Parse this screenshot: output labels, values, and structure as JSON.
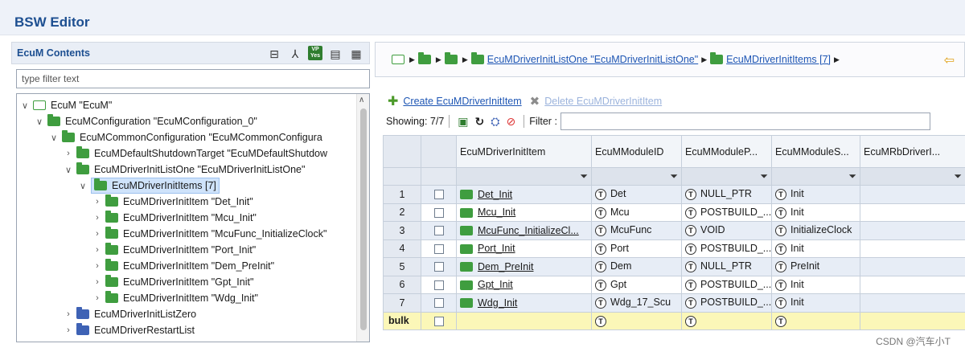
{
  "app": {
    "title": "BSW Editor"
  },
  "left": {
    "title": "EcuM Contents",
    "filter_placeholder": "type filter text",
    "tree": [
      {
        "label": "EcuM \"EcuM\"",
        "twisty": "open",
        "icon": "empty"
      },
      {
        "label": "EcuMConfiguration \"EcuMConfiguration_0\"",
        "twisty": "open",
        "icon": "green"
      },
      {
        "label": "EcuMCommonConfiguration \"EcuMCommonConfigura",
        "twisty": "open",
        "icon": "green"
      },
      {
        "label": "EcuMDefaultShutdownTarget \"EcuMDefaultShutdow",
        "twisty": "closed",
        "icon": "green"
      },
      {
        "label": "EcuMDriverInitListOne \"EcuMDriverInitListOne\"",
        "twisty": "open",
        "icon": "green"
      },
      {
        "label": "EcuMDriverInitItems [7]",
        "twisty": "open",
        "icon": "green",
        "selected": true
      },
      {
        "label": "EcuMDriverInitItem \"Det_Init\"",
        "twisty": "closed",
        "icon": "green"
      },
      {
        "label": "EcuMDriverInitItem \"Mcu_Init\"",
        "twisty": "closed",
        "icon": "green"
      },
      {
        "label": "EcuMDriverInitItem \"McuFunc_InitializeClock\"",
        "twisty": "closed",
        "icon": "green"
      },
      {
        "label": "EcuMDriverInitItem \"Port_Init\"",
        "twisty": "closed",
        "icon": "green"
      },
      {
        "label": "EcuMDriverInitItem \"Dem_PreInit\"",
        "twisty": "closed",
        "icon": "green"
      },
      {
        "label": "EcuMDriverInitItem \"Gpt_Init\"",
        "twisty": "closed",
        "icon": "green"
      },
      {
        "label": "EcuMDriverInitItem \"Wdg_Init\"",
        "twisty": "closed",
        "icon": "green"
      },
      {
        "label": "EcuMDriverInitListZero",
        "twisty": "closed",
        "icon": "blue"
      },
      {
        "label": "EcuMDriverRestartList",
        "twisty": "closed",
        "icon": "blue"
      }
    ]
  },
  "breadcrumb": {
    "link1": "EcuMDriverInitListOne \"EcuMDriverInitListOne\"",
    "link2": "EcuMDriverInitItems [7]"
  },
  "toolbar": {
    "create_label": "Create EcuMDriverInitItem",
    "delete_label": "Delete EcuMDriverInitItem",
    "showing": "Showing: 7/7",
    "filter_label": "Filter :"
  },
  "table": {
    "headers": [
      "EcuMDriverInitItem",
      "EcuMModuleID",
      "EcuMModuleP...",
      "EcuMModuleS...",
      "EcuMRbDriverI..."
    ],
    "rows": [
      {
        "num": "1",
        "item": "Det_Init",
        "id": "Det",
        "p": "NULL_PTR",
        "s": "Init"
      },
      {
        "num": "2",
        "item": "Mcu_Init",
        "id": "Mcu",
        "p": "POSTBUILD_...",
        "s": "Init"
      },
      {
        "num": "3",
        "item": "McuFunc_InitializeCl...",
        "id": "McuFunc",
        "p": "VOID",
        "s": "InitializeClock"
      },
      {
        "num": "4",
        "item": "Port_Init",
        "id": "Port",
        "p": "POSTBUILD_...",
        "s": "Init"
      },
      {
        "num": "5",
        "item": "Dem_PreInit",
        "id": "Dem",
        "p": "NULL_PTR",
        "s": "PreInit"
      },
      {
        "num": "6",
        "item": "Gpt_Init",
        "id": "Gpt",
        "p": "POSTBUILD_...",
        "s": "Init"
      },
      {
        "num": "7",
        "item": "Wdg_Init",
        "id": "Wdg_17_Scu",
        "p": "POSTBUILD_...",
        "s": "Init"
      }
    ],
    "bulk_label": "bulk"
  },
  "watermark": "CSDN @汽车小T"
}
